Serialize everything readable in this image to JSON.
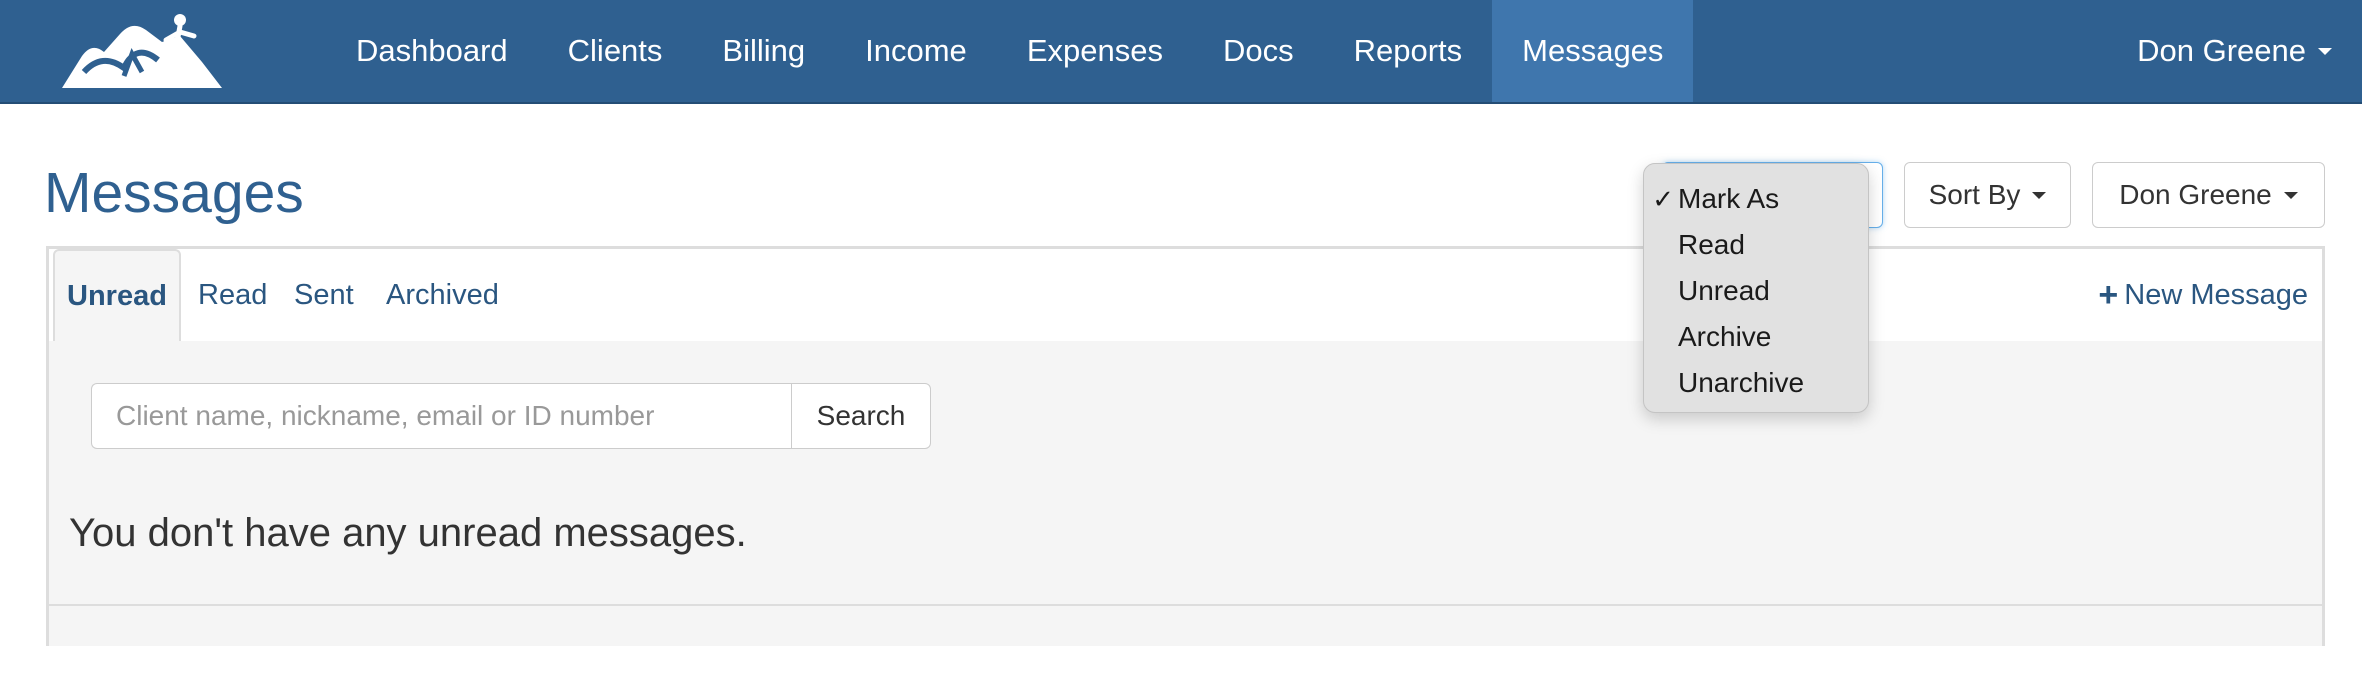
{
  "navbar": {
    "items": [
      {
        "label": "Dashboard",
        "active": false
      },
      {
        "label": "Clients",
        "active": false
      },
      {
        "label": "Billing",
        "active": false
      },
      {
        "label": "Income",
        "active": false
      },
      {
        "label": "Expenses",
        "active": false
      },
      {
        "label": "Docs",
        "active": false
      },
      {
        "label": "Reports",
        "active": false
      },
      {
        "label": "Messages",
        "active": true
      }
    ],
    "user": "Don Greene"
  },
  "page": {
    "title": "Messages"
  },
  "toolbar": {
    "sort_label": "Sort By",
    "user_label": "Don Greene"
  },
  "tabs": [
    {
      "label": "Unread",
      "active": true
    },
    {
      "label": "Read",
      "active": false
    },
    {
      "label": "Sent",
      "active": false
    },
    {
      "label": "Archived",
      "active": false
    }
  ],
  "new_message": "New Message",
  "search": {
    "placeholder": "Client name, nickname, email or ID number",
    "button": "Search"
  },
  "empty_message": "You don't have any unread messages.",
  "mark_as_menu": {
    "items": [
      {
        "label": "Mark As",
        "checked": true
      },
      {
        "label": "Read",
        "checked": false
      },
      {
        "label": "Unread",
        "checked": false
      },
      {
        "label": "Archive",
        "checked": false
      },
      {
        "label": "Unarchive",
        "checked": false
      }
    ]
  },
  "colors": {
    "navbar": "#2f6090",
    "navbar_active": "#3f76ad",
    "link": "#2a5680",
    "title": "#2f6090"
  },
  "icons": {
    "logo": "hiker-on-mountain-logo",
    "new_message": "plus-icon",
    "checkmark": "checkmark-icon"
  }
}
